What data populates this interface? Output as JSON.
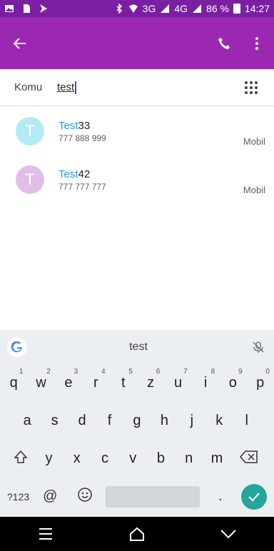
{
  "status_bar": {
    "network_text": "3G",
    "network_text_2": "4G",
    "battery_text": "86 %",
    "time": "14:27"
  },
  "app_bar": {
    "color": "#9c27b0"
  },
  "to_field": {
    "label": "Komu",
    "value": "test"
  },
  "contacts": [
    {
      "initial": "T",
      "avatar_color": "#b2ebf2",
      "highlight": "Test",
      "rest": "33",
      "phone": "777 888 999",
      "type": "Mobil"
    },
    {
      "initial": "T",
      "avatar_color": "#e1bee7",
      "highlight": "Test",
      "rest": "42",
      "phone": "777 777 777",
      "type": "Mobil"
    }
  ],
  "keyboard": {
    "suggestion": "test",
    "row1": [
      {
        "k": "q",
        "n": "1"
      },
      {
        "k": "w",
        "n": "2"
      },
      {
        "k": "e",
        "n": "3"
      },
      {
        "k": "r",
        "n": "4"
      },
      {
        "k": "t",
        "n": "5"
      },
      {
        "k": "z",
        "n": "6"
      },
      {
        "k": "u",
        "n": "7"
      },
      {
        "k": "i",
        "n": "8"
      },
      {
        "k": "o",
        "n": "9"
      },
      {
        "k": "p",
        "n": "0"
      }
    ],
    "row2": [
      "a",
      "s",
      "d",
      "f",
      "g",
      "h",
      "j",
      "k",
      "l"
    ],
    "row3": [
      "y",
      "x",
      "c",
      "v",
      "b",
      "n",
      "m"
    ],
    "bottom": {
      "symbols": "?123",
      "at": "@",
      "period": "."
    }
  }
}
